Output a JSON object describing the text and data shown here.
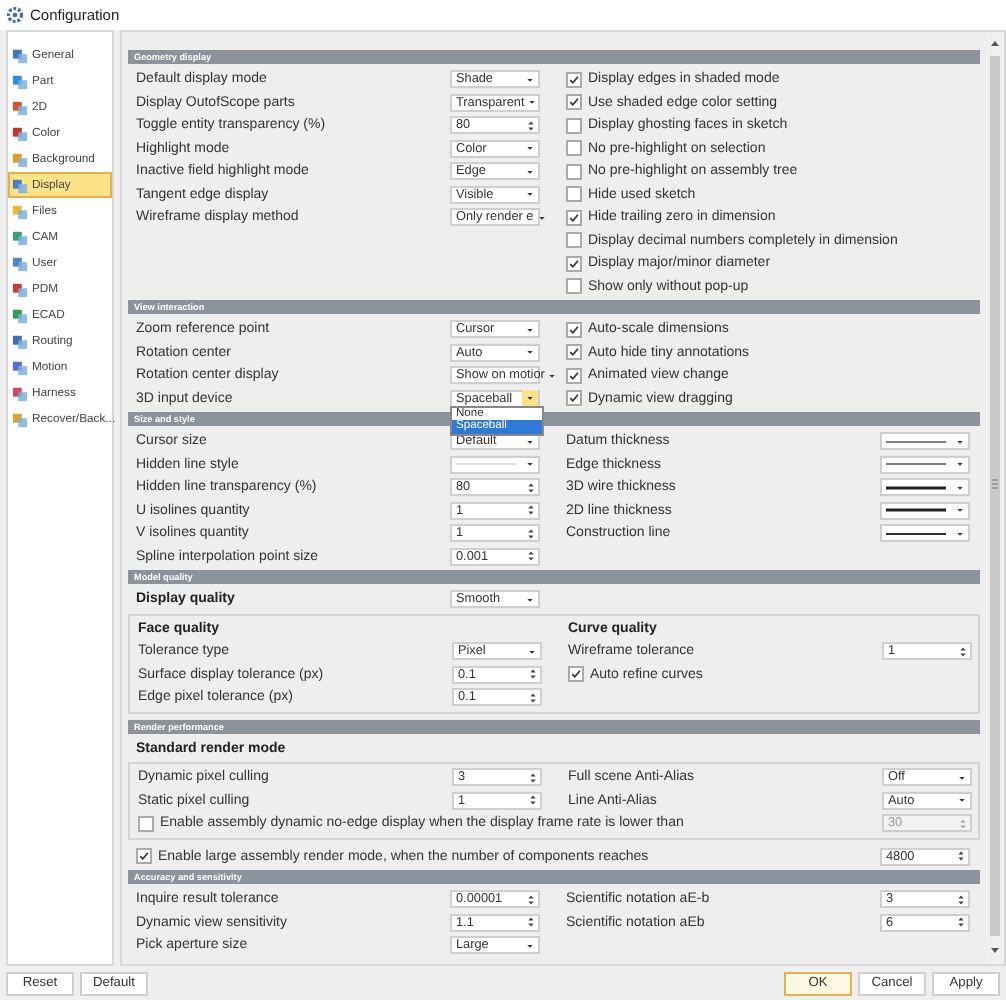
{
  "window": {
    "title": "Configuration"
  },
  "sidebar": {
    "items": [
      {
        "label": "General",
        "selected": false
      },
      {
        "label": "Part",
        "selected": false
      },
      {
        "label": "2D",
        "selected": false
      },
      {
        "label": "Color",
        "selected": false
      },
      {
        "label": "Background",
        "selected": false
      },
      {
        "label": "Display",
        "selected": true
      },
      {
        "label": "Files",
        "selected": false
      },
      {
        "label": "CAM",
        "selected": false
      },
      {
        "label": "User",
        "selected": false
      },
      {
        "label": "PDM",
        "selected": false
      },
      {
        "label": "ECAD",
        "selected": false
      },
      {
        "label": "Routing",
        "selected": false
      },
      {
        "label": "Motion",
        "selected": false
      },
      {
        "label": "Harness",
        "selected": false
      },
      {
        "label": "Recover/Back...",
        "selected": false
      }
    ]
  },
  "sections": [
    {
      "title": "Geometry display",
      "rows": [
        {
          "kind": "pair",
          "left": {
            "kind": "field",
            "label": "Default display mode",
            "control": {
              "kind": "select",
              "value": "Shade"
            }
          },
          "right": {
            "kind": "checkbox",
            "label": "Display edges in shaded mode",
            "checked": true
          }
        },
        {
          "kind": "pair",
          "left": {
            "kind": "field",
            "label": "Display OutofScope parts",
            "control": {
              "kind": "select",
              "value": "Transparent"
            }
          },
          "right": {
            "kind": "checkbox",
            "label": "Use shaded edge color setting",
            "checked": true
          }
        },
        {
          "kind": "pair",
          "left": {
            "kind": "field",
            "label": "Toggle entity transparency (%)",
            "control": {
              "kind": "spin",
              "value": "80"
            }
          },
          "right": {
            "kind": "checkbox",
            "label": "Display ghosting faces in sketch",
            "checked": false
          }
        },
        {
          "kind": "pair",
          "left": {
            "kind": "field",
            "label": "Highlight mode",
            "control": {
              "kind": "select",
              "value": "Color"
            }
          },
          "right": {
            "kind": "checkbox",
            "label": "No pre-highlight on selection",
            "checked": false
          }
        },
        {
          "kind": "pair",
          "left": {
            "kind": "field",
            "label": "Inactive field highlight mode",
            "control": {
              "kind": "select",
              "value": "Edge"
            }
          },
          "right": {
            "kind": "checkbox",
            "label": "No pre-highlight on assembly tree",
            "checked": false
          }
        },
        {
          "kind": "pair",
          "left": {
            "kind": "field",
            "label": "Tangent edge display",
            "control": {
              "kind": "select",
              "value": "Visible"
            }
          },
          "right": {
            "kind": "checkbox",
            "label": "Hide used sketch",
            "checked": false
          }
        },
        {
          "kind": "pair",
          "left": {
            "kind": "field",
            "label": "Wireframe display method",
            "control": {
              "kind": "select",
              "value": "Only render e"
            }
          },
          "right": {
            "kind": "checkbox",
            "label": "Hide trailing zero in dimension",
            "checked": true
          }
        },
        {
          "kind": "pair",
          "right": {
            "kind": "checkbox",
            "label": "Display decimal numbers completely in dimension",
            "checked": false
          }
        },
        {
          "kind": "pair",
          "right": {
            "kind": "checkbox",
            "label": "Display major/minor diameter",
            "checked": true
          }
        },
        {
          "kind": "pair",
          "right": {
            "kind": "checkbox",
            "label": "Show only without pop-up",
            "checked": false
          }
        }
      ]
    },
    {
      "title": "View interaction",
      "rows": [
        {
          "kind": "pair",
          "left": {
            "kind": "field",
            "label": "Zoom reference point",
            "control": {
              "kind": "select",
              "value": "Cursor"
            }
          },
          "right": {
            "kind": "checkbox",
            "label": "Auto-scale dimensions",
            "checked": true
          }
        },
        {
          "kind": "pair",
          "left": {
            "kind": "field",
            "label": "Rotation center",
            "control": {
              "kind": "select",
              "value": "Auto"
            }
          },
          "right": {
            "kind": "checkbox",
            "label": "Auto hide tiny annotations",
            "checked": true
          }
        },
        {
          "kind": "pair",
          "left": {
            "kind": "field",
            "label": "Rotation center display",
            "control": {
              "kind": "select",
              "value": "Show on motior"
            }
          },
          "right": {
            "kind": "checkbox",
            "label": "Animated view change",
            "checked": true
          }
        },
        {
          "kind": "pair",
          "left": {
            "kind": "field",
            "label": "3D input device",
            "control": {
              "kind": "select",
              "value": "Spaceball",
              "options": [
                {
                  "label": "None",
                  "selected": false
                },
                {
                  "label": "Spaceball",
                  "selected": true
                }
              ]
            }
          },
          "right": {
            "kind": "checkbox",
            "label": "Dynamic view dragging",
            "checked": true
          }
        }
      ]
    },
    {
      "title": "Size and style",
      "rows": [
        {
          "kind": "pair",
          "left": {
            "kind": "field",
            "label": "Cursor size",
            "control": {
              "kind": "select",
              "value": "Default"
            }
          },
          "right": {
            "kind": "field",
            "label": "Datum thickness",
            "control": {
              "kind": "thin-line"
            }
          }
        },
        {
          "kind": "pair",
          "left": {
            "kind": "field",
            "label": "Hidden line style",
            "control": {
              "kind": "hairline"
            }
          },
          "right": {
            "kind": "field",
            "label": "Edge thickness",
            "control": {
              "kind": "thin-line"
            }
          }
        },
        {
          "kind": "pair",
          "left": {
            "kind": "field",
            "label": "Hidden line transparency (%)",
            "control": {
              "kind": "spin",
              "value": "80"
            }
          },
          "right": {
            "kind": "field",
            "label": "3D wire thickness",
            "control": {
              "kind": "thick-line"
            }
          }
        },
        {
          "kind": "pair",
          "left": {
            "kind": "field",
            "label": "U isolines quantity",
            "control": {
              "kind": "spin",
              "value": "1"
            }
          },
          "right": {
            "kind": "field",
            "label": "2D line thickness",
            "control": {
              "kind": "thick-line"
            }
          }
        },
        {
          "kind": "pair",
          "left": {
            "kind": "field",
            "label": "V isolines quantity",
            "control": {
              "kind": "spin",
              "value": "1"
            }
          },
          "right": {
            "kind": "field",
            "label": "Construction line",
            "control": {
              "kind": "medium-line"
            }
          }
        },
        {
          "kind": "pair",
          "left": {
            "kind": "field",
            "label": "Spline interpolation point size",
            "control": {
              "kind": "spin",
              "value": "0.001"
            }
          }
        }
      ]
    },
    {
      "title": "Model quality",
      "rows": [
        {
          "kind": "pair",
          "left": {
            "kind": "strong-field",
            "label": "Display quality",
            "control": {
              "kind": "select",
              "value": "Smooth"
            }
          }
        },
        {
          "kind": "group",
          "rows": [
            {
              "kind": "pair",
              "left": {
                "kind": "heading",
                "label": "Face quality"
              },
              "right": {
                "kind": "heading",
                "label": "Curve quality"
              }
            },
            {
              "kind": "pair",
              "left": {
                "kind": "field",
                "label": "Tolerance type",
                "control": {
                  "kind": "select",
                  "value": "Pixel"
                }
              },
              "right": {
                "kind": "field",
                "label": "Wireframe tolerance",
                "control": {
                  "kind": "spin",
                  "value": "1"
                }
              }
            },
            {
              "kind": "pair",
              "left": {
                "kind": "field",
                "label": "Surface display tolerance (px)",
                "control": {
                  "kind": "spin",
                  "value": "0.1"
                }
              },
              "right": {
                "kind": "checkbox",
                "label": "Auto refine curves",
                "checked": true
              }
            },
            {
              "kind": "pair",
              "left": {
                "kind": "field",
                "label": "Edge pixel tolerance (px)",
                "control": {
                  "kind": "spin",
                  "value": "0.1"
                }
              }
            }
          ]
        }
      ]
    },
    {
      "title": "Render performance",
      "rows": [
        {
          "kind": "pair",
          "left": {
            "kind": "heading",
            "label": "Standard render mode"
          }
        },
        {
          "kind": "group",
          "rows": [
            {
              "kind": "pair",
              "left": {
                "kind": "field",
                "label": "Dynamic pixel culling",
                "control": {
                  "kind": "spin",
                  "value": "3"
                }
              },
              "right": {
                "kind": "field",
                "label": "Full scene Anti-Alias",
                "control": {
                  "kind": "select",
                  "value": "Off"
                }
              }
            },
            {
              "kind": "pair",
              "left": {
                "kind": "field",
                "label": "Static pixel culling",
                "control": {
                  "kind": "spin",
                  "value": "1"
                }
              },
              "right": {
                "kind": "field",
                "label": "Line Anti-Alias",
                "control": {
                  "kind": "select",
                  "value": "Auto"
                }
              }
            },
            {
              "kind": "wide",
              "item": {
                "kind": "checkbox",
                "label": "Enable assembly dynamic no-edge display when the display frame rate is lower than",
                "checked": false
              },
              "control": {
                "kind": "spin",
                "value": "30",
                "disabled": true
              }
            }
          ]
        },
        {
          "kind": "wide",
          "item": {
            "kind": "checkbox",
            "label": "Enable large assembly render mode, when the number of components reaches",
            "checked": true
          },
          "control": {
            "kind": "spin",
            "value": "4800",
            "disabled": false
          }
        }
      ]
    },
    {
      "title": "Accuracy and sensitivity",
      "rows": [
        {
          "kind": "pair",
          "left": {
            "kind": "field",
            "label": "Inquire result tolerance",
            "control": {
              "kind": "spin",
              "value": "0.00001"
            }
          },
          "right": {
            "kind": "field",
            "label": "Scientific notation aE-b",
            "control": {
              "kind": "spin",
              "value": "3"
            }
          }
        },
        {
          "kind": "pair",
          "left": {
            "kind": "field",
            "label": "Dynamic view sensitivity",
            "control": {
              "kind": "spin",
              "value": "1.1"
            }
          },
          "right": {
            "kind": "field",
            "label": "Scientific notation aEb",
            "control": {
              "kind": "spin",
              "value": "6"
            }
          }
        },
        {
          "kind": "pair",
          "left": {
            "kind": "field",
            "label": "Pick aperture size",
            "control": {
              "kind": "select",
              "value": "Large"
            }
          }
        }
      ]
    }
  ],
  "footer": {
    "left_buttons": [
      {
        "label": "Reset",
        "default": false
      },
      {
        "label": "Default",
        "default": false
      }
    ],
    "right_buttons": [
      {
        "label": "OK",
        "default": true
      },
      {
        "label": "Cancel",
        "default": false
      },
      {
        "label": "Apply",
        "default": false
      }
    ]
  }
}
